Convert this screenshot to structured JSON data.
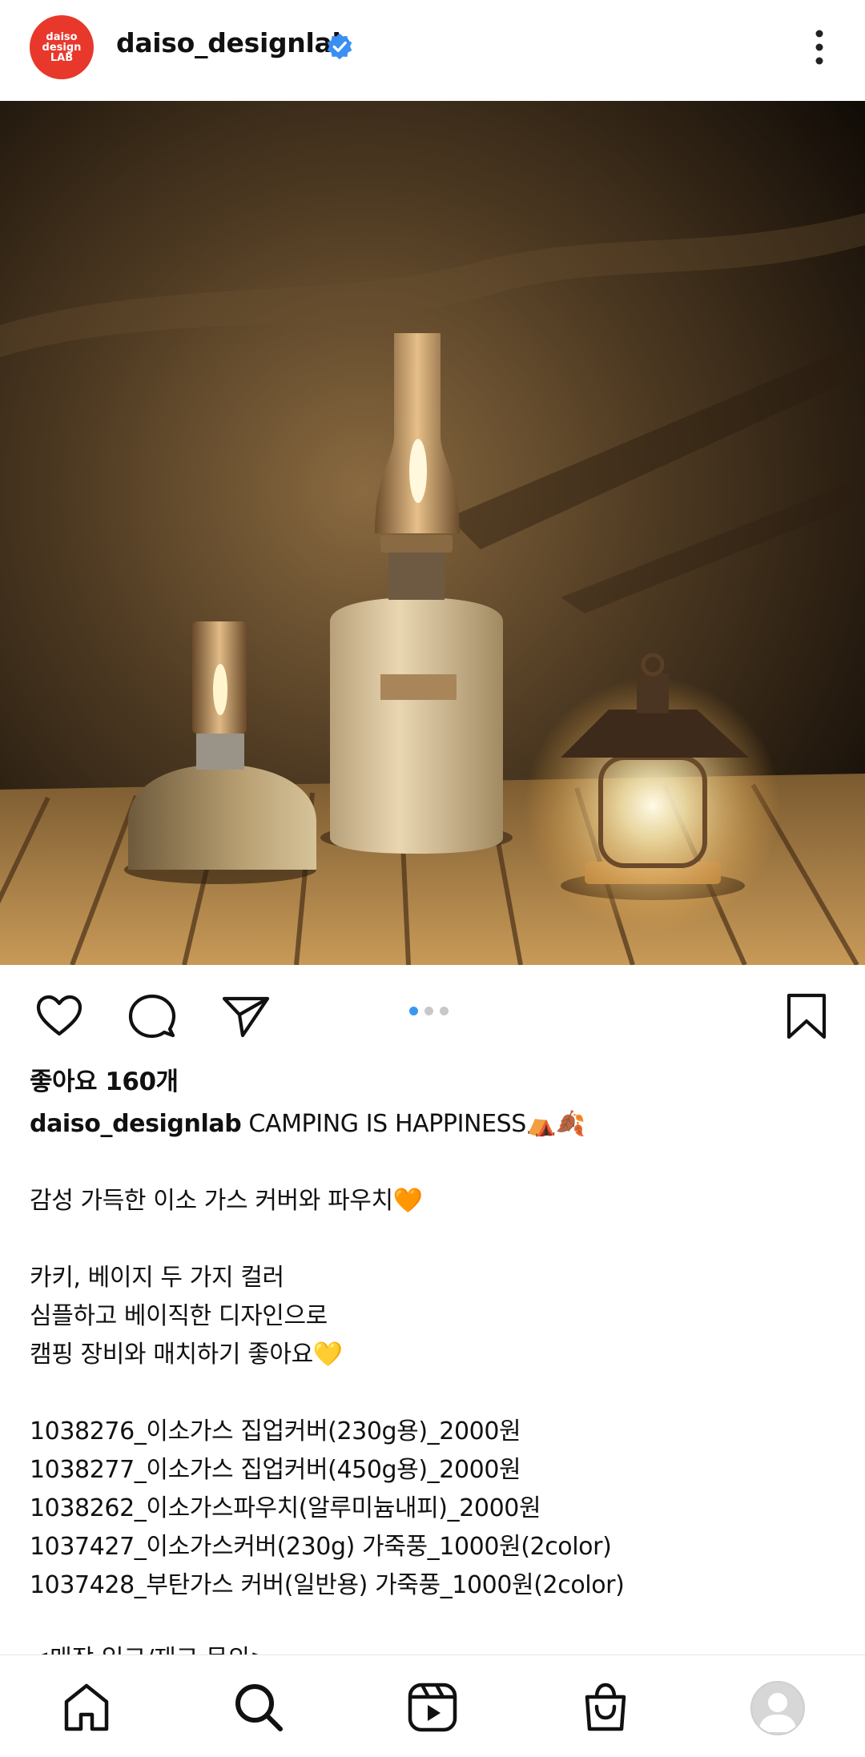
{
  "header": {
    "avatar_lines": [
      "daiso",
      "design",
      "LAB"
    ],
    "username": "daiso_designlab",
    "verified": true
  },
  "carousel": {
    "count": 3,
    "active": 1
  },
  "post": {
    "likes": "좋아요 160개",
    "caption_user": "daiso_designlab",
    "caption_lines": [
      "CAMPING IS HAPPINESS⛺🍂",
      "",
      "감성 가득한 이소 가스 커버와 파우치🧡",
      "",
      "카키, 베이지 두 가지 컬러",
      "심플하고 베이직한 디자인으로",
      "캠핑 장비와 매치하기 좋아요💛",
      "",
      "1038276_이소가스 집업커버(230g용)_2000원",
      "1038277_이소가스 집업커버(450g용)_2000원",
      "1038262_이소가스파우치(알루미늄내피)_2000원",
      "1037427_이소가스커버(230g) 가죽풍_1000원(2color)",
      "1037428_부탄가스 커버(일반용) 가죽풍_1000원(2color)"
    ],
    "partial_line": "<매장 입고/재고 문의>"
  },
  "icons": {
    "like": "heart-icon",
    "comment": "comment-icon",
    "share": "send-icon",
    "save": "bookmark-icon",
    "more": "more-vertical-icon"
  },
  "nav": [
    "home-icon",
    "search-icon",
    "reels-icon",
    "shop-icon",
    "profile-avatar"
  ],
  "colors": {
    "accent": "#3897f0",
    "brand": "#e8382c",
    "verified": "#3b8ff3"
  }
}
